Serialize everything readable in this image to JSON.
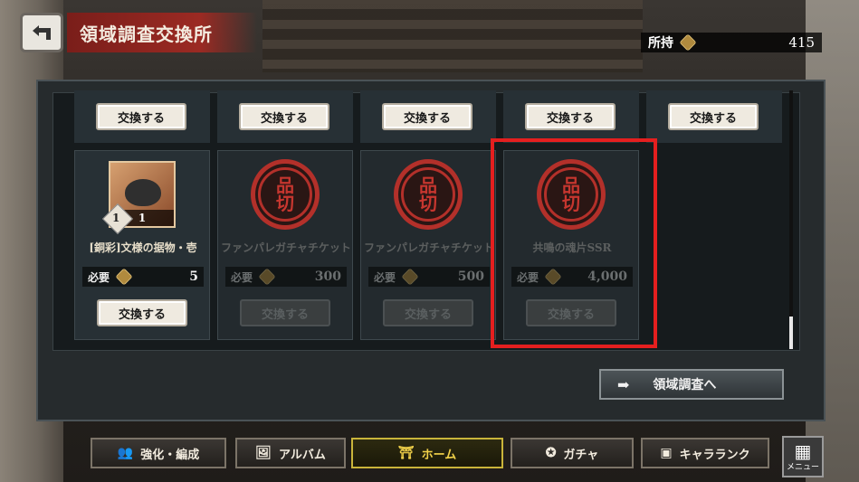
{
  "header": {
    "title": "領域調査交換所",
    "owned_label": "所持",
    "owned_value": "415"
  },
  "top_buttons": [
    "交換する",
    "交換する",
    "交換する",
    "交換する",
    "交換する"
  ],
  "items": [
    {
      "name": "[銅彩]文様の据物・壱",
      "required_label": "必要",
      "cost": "5",
      "count": "1",
      "rarity": "1",
      "button": "交換する",
      "enabled": true
    },
    {
      "name": "ファンパレガチャチケット",
      "required_label": "必要",
      "cost": "300",
      "button": "交換する",
      "enabled": false
    },
    {
      "name": "ファンパレガチャチケット",
      "required_label": "必要",
      "cost": "500",
      "button": "交換する",
      "enabled": false
    },
    {
      "name": "共鳴の魂片SSR",
      "required_label": "必要",
      "cost": "4,000",
      "button": "交換する",
      "enabled": false
    }
  ],
  "goto_button": "領域調査へ",
  "nav": [
    {
      "label": "強化・編成",
      "icon": "team-icon"
    },
    {
      "label": "アルバム",
      "icon": "album-icon"
    },
    {
      "label": "ホーム",
      "icon": "home-icon",
      "active": true
    },
    {
      "label": "ガチャ",
      "icon": "gacha-icon"
    },
    {
      "label": "キャラランク",
      "icon": "chara-rank-icon"
    }
  ],
  "menu_label": "メニュー",
  "seal_glyph": "品\n切",
  "colors": {
    "highlight": "#e51f1f",
    "active_nav": "#c9b43a",
    "seal_red": "#b3302a"
  }
}
